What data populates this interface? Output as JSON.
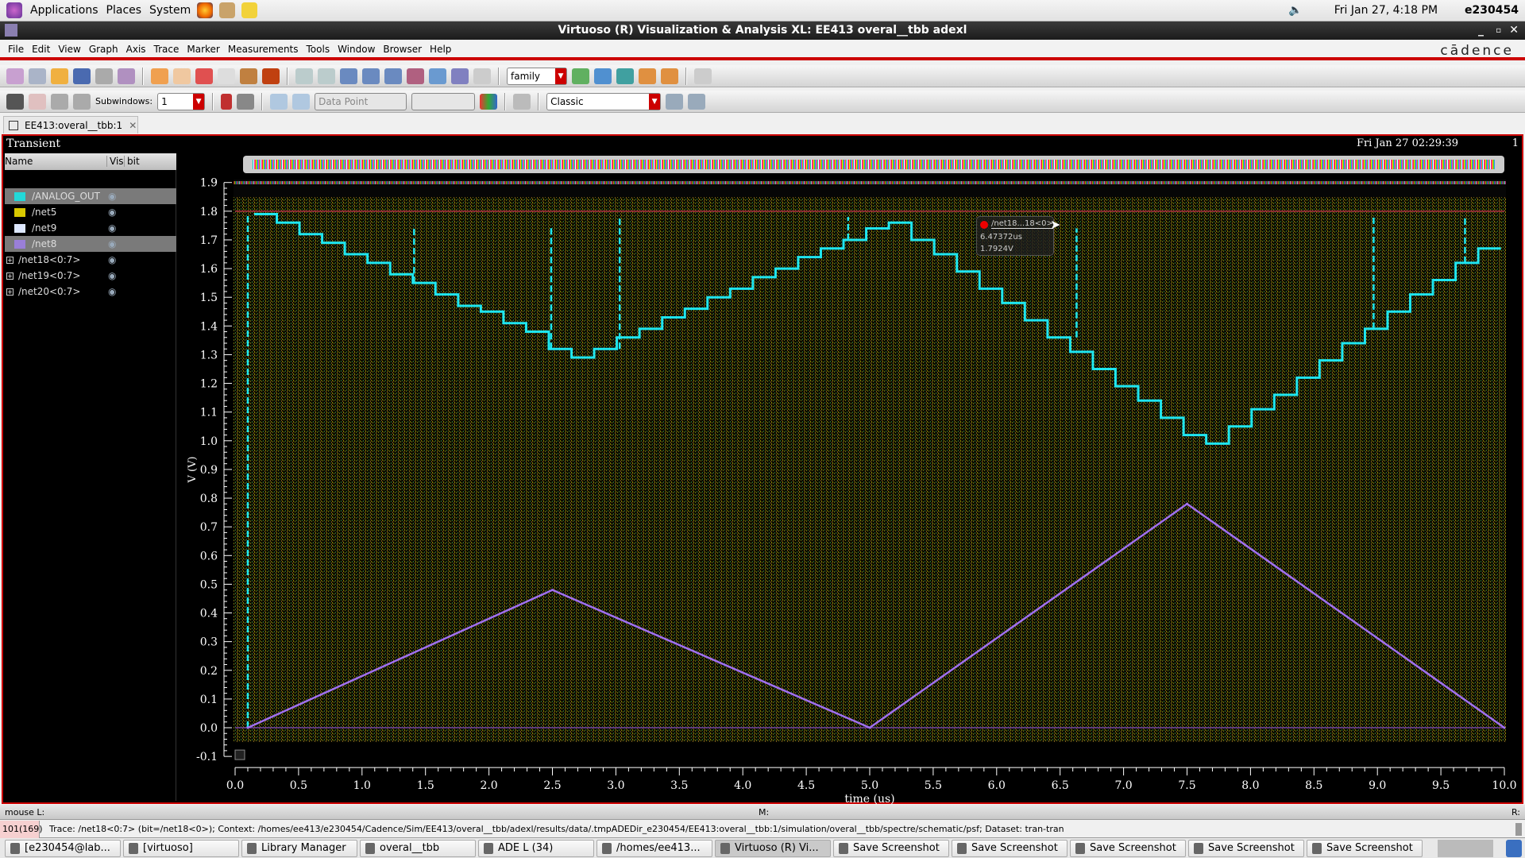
{
  "top_panel": {
    "menus": [
      "Applications",
      "Places",
      "System"
    ],
    "clock": "Fri Jan 27,  4:18 PM",
    "user": "e230454"
  },
  "window": {
    "title": "Virtuoso (R) Visualization & Analysis XL: EE413 overal__tbb adexl",
    "brand": "cādence"
  },
  "menubar": [
    "File",
    "Edit",
    "View",
    "Graph",
    "Axis",
    "Trace",
    "Marker",
    "Measurements",
    "Tools",
    "Window",
    "Browser",
    "Help"
  ],
  "toolbar": {
    "family_value": "family",
    "subwindows_label": "Subwindows:",
    "subwindows_value": "1",
    "datapoint_value": "Data Point",
    "style_value": "Classic"
  },
  "tab": {
    "label": "EE413:overal__tbb:1"
  },
  "plot": {
    "title": "Transient",
    "timestamp": "Fri Jan 27 02:29:39",
    "subwindow_number": "1"
  },
  "trace_list": {
    "headers": [
      "Name",
      "Vis",
      "bit"
    ],
    "rows": [
      {
        "name": "/ANALOG_OUT",
        "color": "#22d8d8",
        "selected": true,
        "expandable": false
      },
      {
        "name": "/net5",
        "color": "#d8c800",
        "selected": false,
        "expandable": false
      },
      {
        "name": "/net9",
        "color": "#dde8ff",
        "selected": false,
        "expandable": false
      },
      {
        "name": "/net8",
        "color": "#9a7fd8",
        "selected": true,
        "expandable": false
      },
      {
        "name": "/net18<0:7>",
        "color": "",
        "selected": false,
        "expandable": true
      },
      {
        "name": "/net19<0:7>",
        "color": "",
        "selected": false,
        "expandable": true
      },
      {
        "name": "/net20<0:7>",
        "color": "",
        "selected": false,
        "expandable": true
      }
    ]
  },
  "tooltip": {
    "trace": "/net18...18<0>",
    "x": "6.47372us",
    "y": "1.7924V"
  },
  "chart_data": {
    "type": "line",
    "xlabel": "time (us)",
    "ylabel": "V (V)",
    "xlim": [
      0,
      10
    ],
    "ylim": [
      -0.1,
      1.9
    ],
    "xticks": [
      "0.0",
      "0.5",
      "1.0",
      "1.5",
      "2.0",
      "2.5",
      "3.0",
      "3.5",
      "4.0",
      "4.5",
      "5.0",
      "5.5",
      "6.0",
      "6.5",
      "7.0",
      "7.5",
      "8.0",
      "8.5",
      "9.0",
      "9.5",
      "10.0"
    ],
    "yticks": [
      "-0.1",
      "0.0",
      "0.1",
      "0.2",
      "0.3",
      "0.4",
      "0.5",
      "0.6",
      "0.7",
      "0.8",
      "0.9",
      "1.0",
      "1.1",
      "1.2",
      "1.3",
      "1.4",
      "1.5",
      "1.6",
      "1.7",
      "1.8",
      "1.9"
    ],
    "series": [
      {
        "name": "/ANALOG_OUT",
        "color": "#1ee6f0",
        "kind": "step",
        "start_us": 0.15,
        "step_us": 0.1786,
        "values": [
          1.79,
          1.76,
          1.72,
          1.69,
          1.65,
          1.62,
          1.58,
          1.55,
          1.51,
          1.47,
          1.45,
          1.41,
          1.38,
          1.32,
          1.29,
          1.32,
          1.36,
          1.39,
          1.43,
          1.46,
          1.5,
          1.53,
          1.57,
          1.6,
          1.64,
          1.67,
          1.7,
          1.74,
          1.76,
          1.7,
          1.65,
          1.59,
          1.53,
          1.48,
          1.42,
          1.36,
          1.31,
          1.25,
          1.19,
          1.14,
          1.08,
          1.02,
          0.99,
          1.05,
          1.11,
          1.16,
          1.22,
          1.28,
          1.34,
          1.39,
          1.45,
          1.51,
          1.56,
          1.62,
          1.67
        ],
        "glitches": [
          [
            0.1,
            0.0,
            1.79
          ],
          [
            1.41,
            1.55,
            1.75
          ],
          [
            2.49,
            1.32,
            1.75
          ],
          [
            3.03,
            1.32,
            1.78
          ],
          [
            4.83,
            1.7,
            1.78
          ],
          [
            6.63,
            1.36,
            1.74
          ],
          [
            8.97,
            1.39,
            1.78
          ],
          [
            9.69,
            1.62,
            1.78
          ]
        ]
      },
      {
        "name": "/net8",
        "color": "#a070f0",
        "kind": "line",
        "x": [
          0.1,
          2.5,
          5.0,
          7.5,
          10.0
        ],
        "y": [
          0.0,
          0.48,
          0.0,
          0.78,
          0.0
        ]
      }
    ]
  },
  "mouse_bar": {
    "left": "mouse L:",
    "middle": "M:",
    "right": "R:"
  },
  "status": {
    "count": "101(169)",
    "message": "Trace: /net18<0:7> (bit=/net18<0>); Context: /homes/ee413/e230454/Cadence/Sim/EE413/overal__tbb/adexl/results/data/.tmpADEDir_e230454/EE413:overal__tbb:1/simulation/overal__tbb/spectre/schematic/psf; Dataset: tran-tran"
  },
  "taskbar": [
    "[e230454@lab...",
    "[virtuoso]",
    "Library Manager",
    "overal__tbb",
    "ADE L (34)",
    "/homes/ee413...",
    "Virtuoso (R) Vi...",
    "Save Screenshot",
    "Save Screenshot",
    "Save Screenshot",
    "Save Screenshot",
    "Save Screenshot"
  ]
}
